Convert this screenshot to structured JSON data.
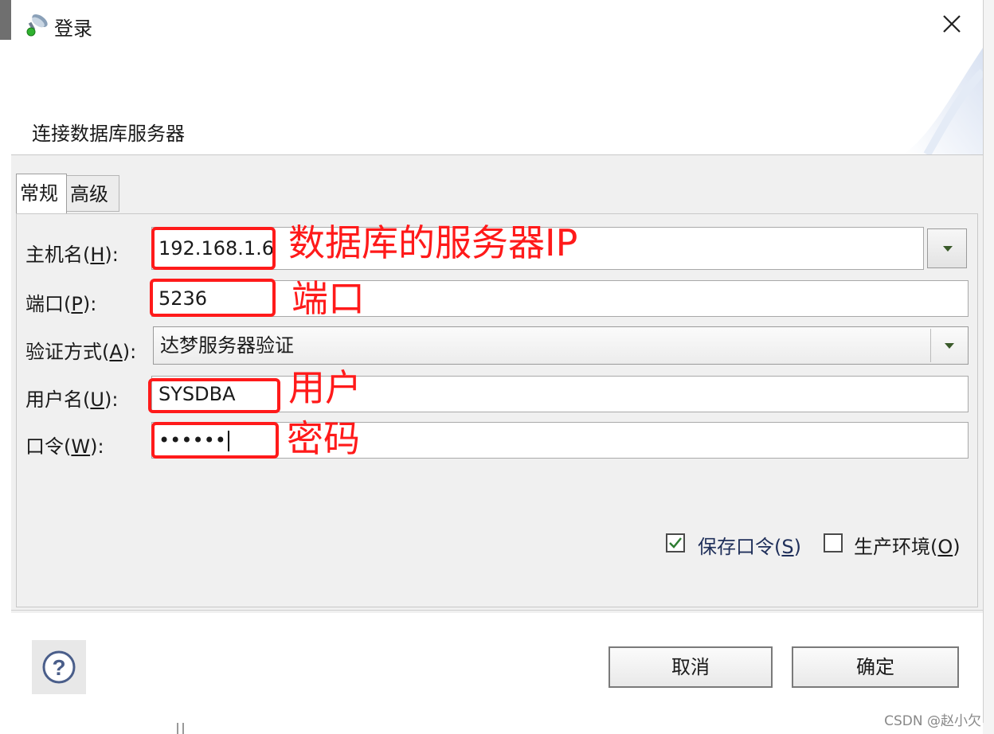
{
  "window": {
    "title": "登录",
    "icon": "database-connect-icon",
    "close_icon": "close-icon"
  },
  "banner": {
    "text": "连接数据库服务器"
  },
  "tabs": [
    {
      "label": "常规"
    },
    {
      "label": "高级"
    }
  ],
  "form": {
    "host": {
      "label_pre": "主机名(",
      "mnemonic": "H",
      "label_post": "):",
      "value": "192.168.1.6"
    },
    "port": {
      "label_pre": "端口(",
      "mnemonic": "P",
      "label_post": "):",
      "value": "5236"
    },
    "auth": {
      "label_pre": "验证方式(",
      "mnemonic": "A",
      "label_post": "):",
      "value": "达梦服务器验证"
    },
    "user": {
      "label_pre": "用户名(",
      "mnemonic": "U",
      "label_post": "):",
      "value": "SYSDBA"
    },
    "password": {
      "label_pre": "口令(",
      "mnemonic": "W",
      "label_post": "):",
      "value": "••••••"
    }
  },
  "annotations": {
    "host": "数据库的服务器IP",
    "port": "端口",
    "user": "用户",
    "password": "密码"
  },
  "options": {
    "save_password": {
      "label_pre": "保存口令(",
      "mnemonic": "S",
      "label_post": ")",
      "checked": true
    },
    "production_env": {
      "label_pre": "生产环境(",
      "mnemonic": "O",
      "label_post": ")",
      "checked": false
    }
  },
  "buttons": {
    "cancel": "取消",
    "ok": "确定",
    "help_icon": "help-icon"
  },
  "watermark": "CSDN @赵小欠",
  "colors": {
    "annotation": "#ff1a1a",
    "check": "#2e7d32"
  }
}
